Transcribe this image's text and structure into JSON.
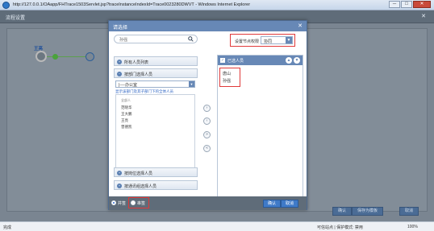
{
  "browser": {
    "title": "http://127.0.0.1/OAapp/FHTrace1503Servlet.jsp?traceInstanceIndexId=Trace0023280DWVT - Windows Internet Explorer",
    "win_min": "─",
    "win_max": "□",
    "win_close": "✕"
  },
  "background": {
    "title": "流程设置",
    "close": "✕",
    "node_label": "王亮",
    "buttons": [
      "确认",
      "保存为模板",
      "取消"
    ]
  },
  "dialog": {
    "title": "请选择",
    "close": "✕",
    "search": {
      "value": "孙强"
    },
    "node_permission": {
      "label": "设置节点权限",
      "value": "协同",
      "arrow": "▼"
    },
    "sections": [
      {
        "icon": "+",
        "label": "所有人员列表"
      },
      {
        "icon": "−",
        "label": "按部门选择人员"
      },
      {
        "icon": "+",
        "label": "按岗位选择人员"
      },
      {
        "icon": "+",
        "label": "按通讯组选择人员"
      }
    ],
    "department": {
      "value": "|----办公室",
      "arrow": "▼"
    },
    "show_link": "显示该部门及其子部门下的全体人员",
    "people": [
      "全部人",
      "范晓华",
      "王大鹏",
      "王亮",
      "曾德凯"
    ],
    "mid_buttons": [
      "›",
      "‹",
      "»",
      "«"
    ],
    "selected_panel": {
      "title": "已选人员",
      "check": "✓",
      "up": "▲",
      "down": "▼",
      "names": [
        "唐山",
        "孙强"
      ]
    },
    "footer": {
      "radio_parallel": "并签",
      "radio_serial": "串签",
      "ok": "确认",
      "cancel": "取消"
    }
  },
  "statusbar": {
    "left": "完成",
    "security": "可信站点 | 保护模式: 禁用",
    "zoom": "100%"
  }
}
